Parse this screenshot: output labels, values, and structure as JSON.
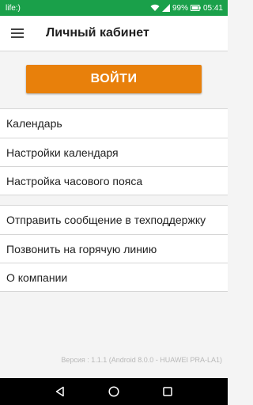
{
  "status_bar": {
    "carrier": "life:)",
    "battery": "99%",
    "time": "05:41",
    "icons": [
      "wifi-icon",
      "signal-icon",
      "battery-icon"
    ]
  },
  "toolbar": {
    "menu_icon": "hamburger-menu-icon",
    "title": "Личный кабинет"
  },
  "login": {
    "label": "ВОЙТИ",
    "color": "#e8800b"
  },
  "menu": {
    "group1": [
      {
        "label": "Календарь"
      },
      {
        "label": "Настройки календаря"
      },
      {
        "label": "Настройка часового пояса"
      }
    ],
    "group2": [
      {
        "label": "Отправить сообщение в техподдержку"
      },
      {
        "label": "Позвонить на горячую линию"
      },
      {
        "label": "О компании"
      }
    ]
  },
  "footer": {
    "version": "Версия : 1.1.1 (Android 8.0.0 - HUAWEI PRA-LA1)"
  },
  "nav_bar": {
    "icons": [
      "back-icon",
      "home-icon",
      "recents-icon"
    ]
  },
  "colors": {
    "status_bar": "#1aa04a",
    "accent": "#e8800b"
  }
}
